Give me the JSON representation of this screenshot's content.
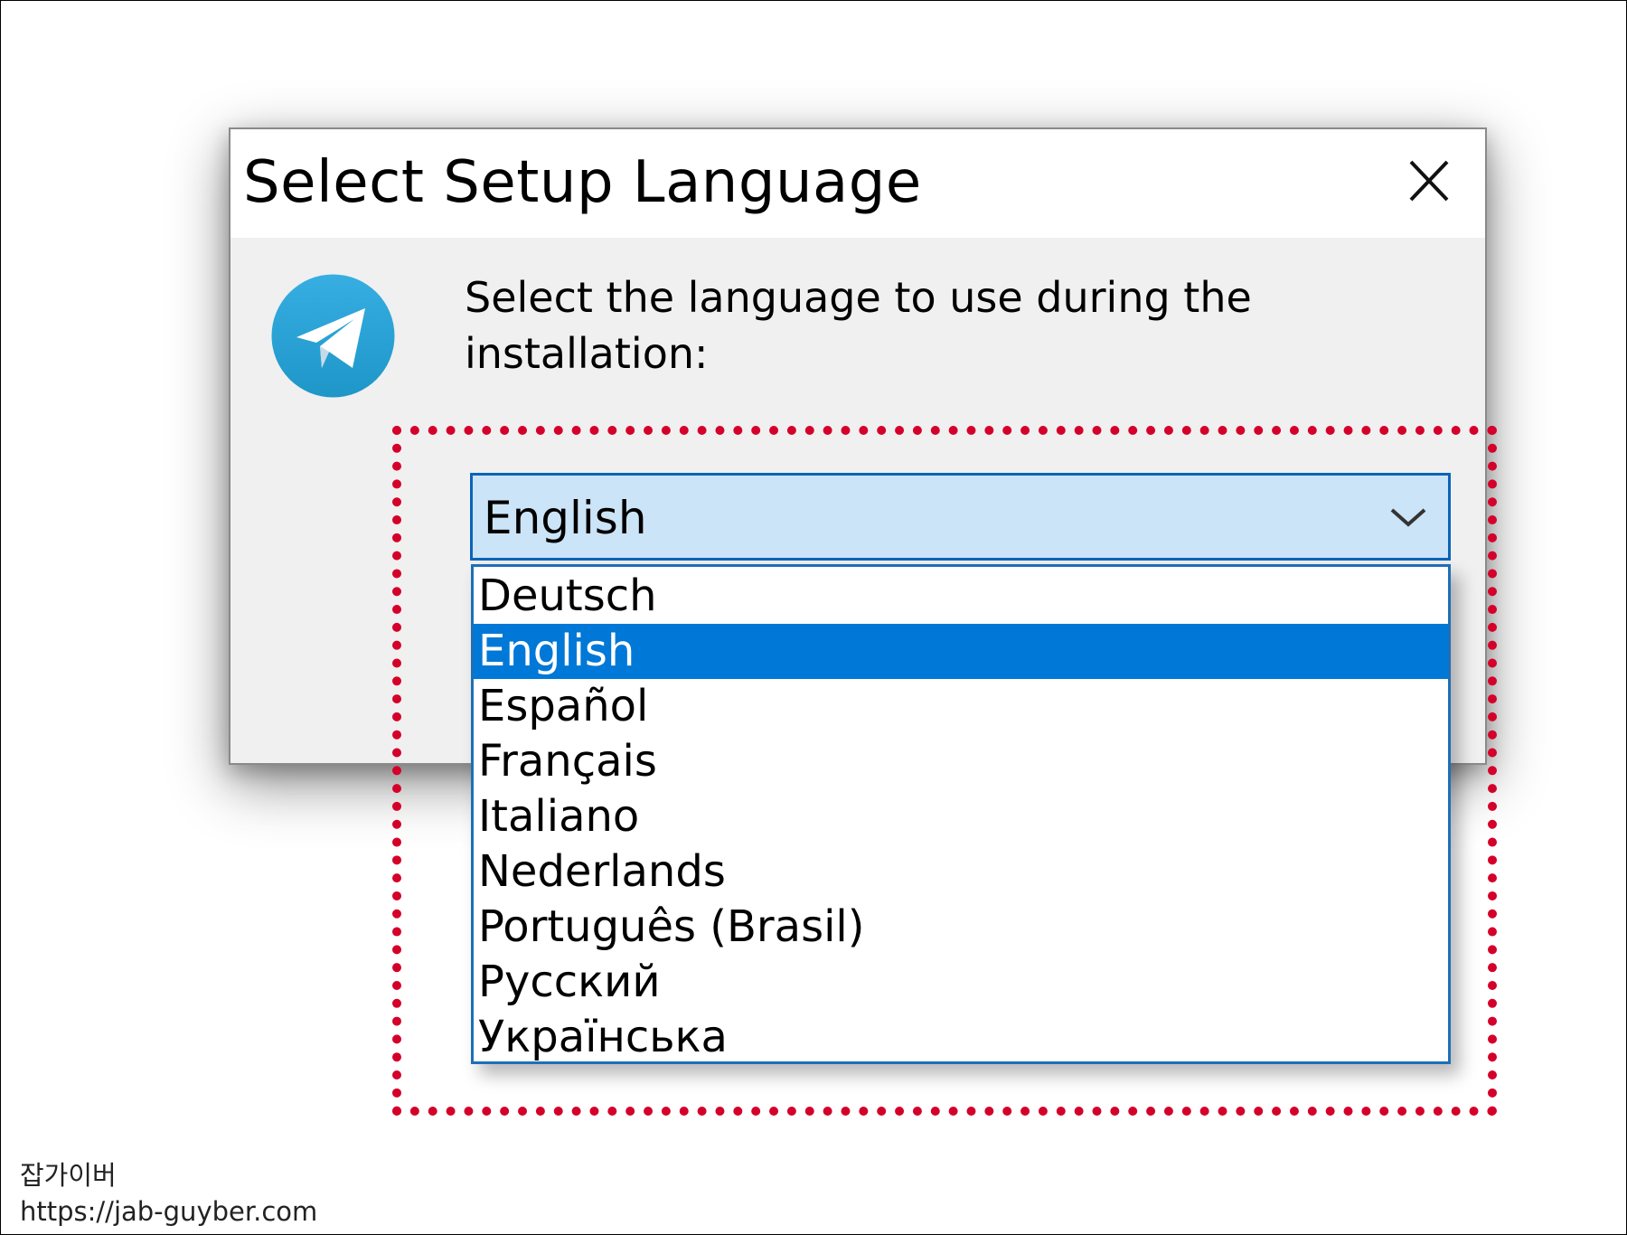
{
  "dialog": {
    "title": "Select Setup Language",
    "close_icon": "close-icon",
    "app_icon": "telegram-logo-icon",
    "prompt": "Select the language to use during the installation:"
  },
  "language_combo": {
    "selected_value": "English",
    "chevron_icon": "chevron-down-icon"
  },
  "language_options": [
    "Deutsch",
    "English",
    "Español",
    "Français",
    "Italiano",
    "Nederlands",
    "Português (Brasil)",
    "Русский",
    "Українська"
  ],
  "selected_option_index": 1,
  "watermark": {
    "name": "잡가이버",
    "url": "https://jab-guyber.com"
  },
  "colors": {
    "highlight_blue": "#0078d7",
    "combo_fill": "#cce4f7",
    "callout_red": "#d4002a",
    "telegram_blue": "#2a9fd8"
  }
}
